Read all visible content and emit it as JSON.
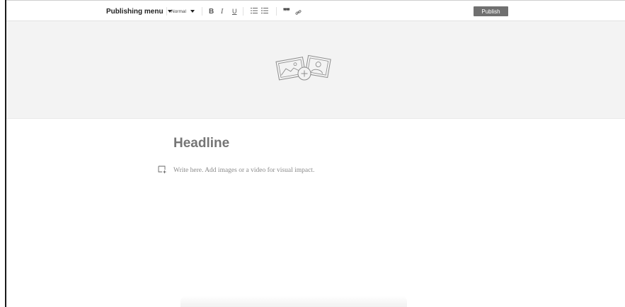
{
  "toolbar": {
    "menu_label": "Publishing menu",
    "style_label": "Normal",
    "bold_label": "B",
    "italic_label": "I",
    "underline_label": "U",
    "quote_label": "❞❞",
    "publish_label": "Publish"
  },
  "icons": {
    "menu_caret": "chevron-down-icon",
    "style_caret": "chevron-down-icon",
    "numbered_list": "numbered-list-icon",
    "bulleted_list": "bulleted-list-icon",
    "quote": "quote-icon",
    "link": "link-icon",
    "cover": "add-cover-image-icon",
    "insert": "insert-media-icon"
  },
  "editor": {
    "headline_placeholder": "Headline",
    "body_placeholder": "Write here. Add images or a video for visual impact."
  },
  "colors": {
    "publish_bg": "#707070",
    "cover_bg": "#f3f3f3",
    "headline_text": "#757575",
    "placeholder_text": "#8a8a8a"
  }
}
